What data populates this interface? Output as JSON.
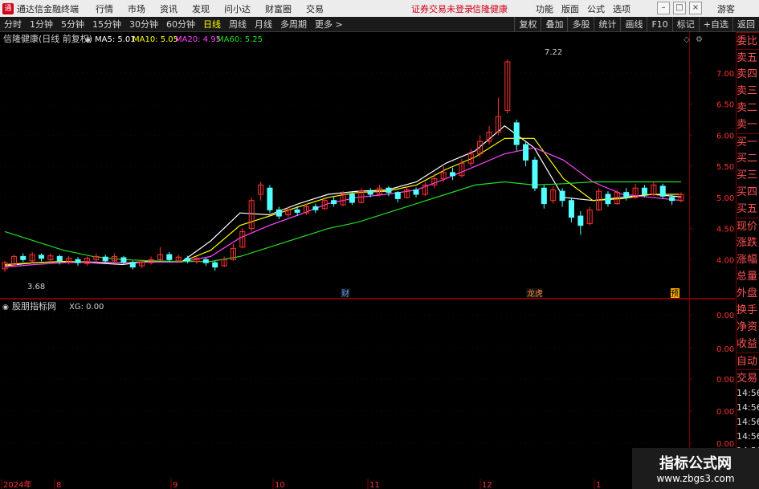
{
  "titlebar": {
    "app_title": "通达信金融终端",
    "logo_glyph": "通",
    "menu": [
      "行情",
      "市场",
      "资讯",
      "发现",
      "问小达",
      "财富圈",
      "交易"
    ],
    "notice": "证券交易未登录",
    "stock_name": "信隆健康",
    "right_menu": [
      "功能",
      "版面",
      "公式",
      "选项"
    ],
    "guest": "游客"
  },
  "tabbar": {
    "periods": [
      "分时",
      "1分钟",
      "5分钟",
      "15分钟",
      "30分钟",
      "60分钟",
      "日线",
      "周线",
      "月线",
      "多周期",
      "更多 >"
    ],
    "active_period": "日线",
    "tools": [
      "复权",
      "叠加",
      "多股",
      "统计",
      "画线",
      "F10",
      "标记",
      "+自选",
      "返回"
    ]
  },
  "main_chart": {
    "header_name": "信隆健康(日线 前复权)",
    "ma": [
      {
        "label": "MA5: 5.01",
        "color": "#ffffff"
      },
      {
        "label": "MA10: 5.05",
        "color": "#ffff00"
      },
      {
        "label": "MA20: 4.95",
        "color": "#ff44ff"
      },
      {
        "label": "MA60: 5.25",
        "color": "#22dd22"
      }
    ],
    "y_ticks": [
      "7.00",
      "6.50",
      "6.00",
      "5.50",
      "5.00",
      "4.50",
      "4.00"
    ],
    "high_label": "7.22",
    "low_label": "3.68",
    "event_markers": [
      "财",
      "龙虎",
      "预"
    ]
  },
  "indicator": {
    "header_name": "股朋指标网",
    "xg_label": "XG: 0.00",
    "y_ticks": [
      "0.00",
      "0.00",
      "0.00",
      "0.00",
      "0.00"
    ]
  },
  "date_axis": [
    "2024年",
    "8",
    "9",
    "10",
    "11",
    "12",
    "1"
  ],
  "side_panel": {
    "items": [
      "委比",
      "卖五",
      "卖四",
      "卖三",
      "卖二",
      "卖一",
      "买一",
      "买二",
      "买三",
      "买四",
      "买五",
      "现价",
      "涨跌",
      "涨幅",
      "总量",
      "外盘",
      "换手",
      "净资",
      "收益"
    ],
    "lower_items": [
      "自动",
      "交易"
    ],
    "times": [
      "14:56",
      "14:56",
      "14:56",
      "14:56",
      "14:56",
      "14:56",
      "14:56",
      "14:56"
    ]
  },
  "watermark": {
    "line1": "指标公式网",
    "line2": "www.zbgs3.com"
  },
  "colors": {
    "up": "#ff3232",
    "down": "#54ffff",
    "ma5": "#ffffff",
    "ma10": "#ffff00",
    "ma20": "#ff44ff",
    "ma60": "#22dd22",
    "grid": "#7a0000"
  },
  "chart_data": {
    "type": "line",
    "title": "信隆健康(日线 前复权)",
    "ylim": [
      3.5,
      7.4
    ],
    "x_labels": [
      "2024年",
      "8",
      "9",
      "10",
      "11",
      "12",
      "1"
    ],
    "series": [
      {
        "name": "MA5",
        "values": [
          3.9,
          3.95,
          3.97,
          3.95,
          3.92,
          3.98,
          3.96,
          4.3,
          4.75,
          4.72,
          4.9,
          5.05,
          5.1,
          5.12,
          5.25,
          5.55,
          5.75,
          6.15,
          5.8,
          5.0,
          4.95,
          5.0,
          5.05,
          5.01
        ]
      },
      {
        "name": "MA10",
        "values": [
          3.92,
          3.95,
          3.97,
          3.96,
          3.95,
          3.97,
          3.96,
          4.15,
          4.55,
          4.7,
          4.85,
          5.0,
          5.08,
          5.1,
          5.2,
          5.45,
          5.65,
          5.95,
          5.95,
          5.3,
          4.95,
          4.98,
          5.05,
          5.05
        ]
      },
      {
        "name": "MA20",
        "values": [
          3.88,
          3.92,
          3.95,
          3.96,
          3.95,
          3.96,
          3.96,
          4.05,
          4.35,
          4.55,
          4.72,
          4.9,
          5.0,
          5.05,
          5.12,
          5.3,
          5.5,
          5.7,
          5.8,
          5.6,
          5.25,
          5.05,
          5.0,
          4.95
        ]
      },
      {
        "name": "MA60",
        "values": [
          4.45,
          4.3,
          4.15,
          4.05,
          4.0,
          3.98,
          3.97,
          3.97,
          4.05,
          4.2,
          4.35,
          4.5,
          4.6,
          4.75,
          4.9,
          5.05,
          5.2,
          5.25,
          5.2,
          5.22,
          5.25,
          5.25,
          5.25,
          5.25
        ]
      }
    ],
    "candles": [
      [
        3.85,
        3.95,
        3.98,
        3.8
      ],
      [
        3.92,
        4.05,
        4.08,
        3.88
      ],
      [
        4.05,
        4.0,
        4.1,
        3.96
      ],
      [
        3.98,
        4.08,
        4.12,
        3.95
      ],
      [
        4.07,
        4.02,
        4.1,
        3.97
      ],
      [
        4.0,
        4.06,
        4.1,
        3.96
      ],
      [
        4.05,
        3.98,
        4.08,
        3.92
      ],
      [
        3.96,
        4.02,
        4.06,
        3.92
      ],
      [
        4.0,
        3.95,
        4.04,
        3.9
      ],
      [
        3.94,
        4.02,
        4.05,
        3.9
      ],
      [
        4.0,
        4.05,
        4.1,
        3.96
      ],
      [
        4.04,
        3.98,
        4.08,
        3.94
      ],
      [
        3.98,
        4.05,
        4.1,
        3.95
      ],
      [
        4.03,
        3.96,
        4.06,
        3.92
      ],
      [
        3.95,
        3.88,
        3.98,
        3.84
      ],
      [
        3.9,
        3.96,
        4.0,
        3.86
      ],
      [
        3.95,
        4.0,
        4.05,
        3.92
      ],
      [
        4.0,
        4.08,
        4.2,
        3.98
      ],
      [
        4.08,
        4.0,
        4.12,
        3.96
      ],
      [
        3.98,
        4.04,
        4.08,
        3.95
      ],
      [
        4.02,
        3.98,
        4.06,
        3.94
      ],
      [
        3.97,
        4.02,
        4.05,
        3.93
      ],
      [
        4.0,
        3.95,
        4.03,
        3.9
      ],
      [
        3.95,
        3.88,
        3.98,
        3.82
      ],
      [
        3.9,
        4.0,
        4.05,
        3.88
      ],
      [
        4.0,
        4.18,
        4.25,
        3.98
      ],
      [
        4.2,
        4.45,
        4.5,
        4.18
      ],
      [
        4.5,
        4.95,
        5.0,
        4.45
      ],
      [
        5.05,
        5.2,
        5.25,
        4.95
      ],
      [
        5.15,
        4.8,
        5.2,
        4.75
      ],
      [
        4.8,
        4.7,
        4.85,
        4.65
      ],
      [
        4.72,
        4.8,
        4.85,
        4.68
      ],
      [
        4.8,
        4.76,
        4.86,
        4.7
      ],
      [
        4.75,
        4.85,
        4.9,
        4.72
      ],
      [
        4.85,
        4.8,
        4.9,
        4.75
      ],
      [
        4.82,
        4.95,
        5.0,
        4.8
      ],
      [
        4.95,
        4.9,
        5.02,
        4.85
      ],
      [
        4.88,
        5.05,
        5.1,
        4.86
      ],
      [
        5.05,
        4.92,
        5.08,
        4.88
      ],
      [
        4.92,
        5.1,
        5.15,
        4.9
      ],
      [
        5.1,
        5.05,
        5.15,
        5.0
      ],
      [
        5.05,
        5.15,
        5.2,
        5.02
      ],
      [
        5.15,
        5.08,
        5.18,
        5.02
      ],
      [
        5.08,
        4.98,
        5.1,
        4.92
      ],
      [
        5.0,
        5.12,
        5.18,
        4.98
      ],
      [
        5.12,
        5.05,
        5.16,
        5.0
      ],
      [
        5.05,
        5.2,
        5.25,
        5.02
      ],
      [
        5.2,
        5.3,
        5.38,
        5.15
      ],
      [
        5.3,
        5.4,
        5.5,
        5.25
      ],
      [
        5.4,
        5.35,
        5.48,
        5.28
      ],
      [
        5.35,
        5.55,
        5.62,
        5.32
      ],
      [
        5.55,
        5.7,
        5.78,
        5.5
      ],
      [
        5.7,
        5.9,
        6.0,
        5.65
      ],
      [
        5.9,
        6.05,
        6.15,
        5.85
      ],
      [
        6.05,
        6.3,
        6.6,
        6.0
      ],
      [
        6.4,
        7.18,
        7.22,
        6.35
      ],
      [
        6.2,
        5.85,
        6.25,
        5.75
      ],
      [
        5.85,
        5.6,
        5.9,
        5.5
      ],
      [
        5.6,
        5.15,
        5.65,
        5.1
      ],
      [
        5.15,
        4.9,
        5.2,
        4.82
      ],
      [
        4.95,
        5.12,
        5.18,
        4.9
      ],
      [
        5.1,
        4.95,
        5.15,
        4.85
      ],
      [
        4.95,
        4.68,
        5.0,
        4.6
      ],
      [
        4.7,
        4.55,
        4.78,
        4.4
      ],
      [
        4.58,
        4.8,
        4.85,
        4.55
      ],
      [
        4.8,
        5.1,
        5.15,
        4.78
      ],
      [
        5.05,
        4.9,
        5.1,
        4.85
      ],
      [
        4.9,
        5.08,
        5.12,
        4.88
      ],
      [
        5.08,
        5.0,
        5.15,
        4.95
      ],
      [
        5.0,
        5.15,
        5.22,
        4.98
      ],
      [
        5.15,
        5.05,
        5.2,
        5.0
      ],
      [
        5.05,
        5.2,
        5.25,
        5.02
      ],
      [
        5.18,
        5.02,
        5.22,
        4.98
      ],
      [
        5.0,
        4.95,
        5.05,
        4.88
      ],
      [
        4.95,
        5.05,
        5.08,
        4.92
      ]
    ]
  }
}
